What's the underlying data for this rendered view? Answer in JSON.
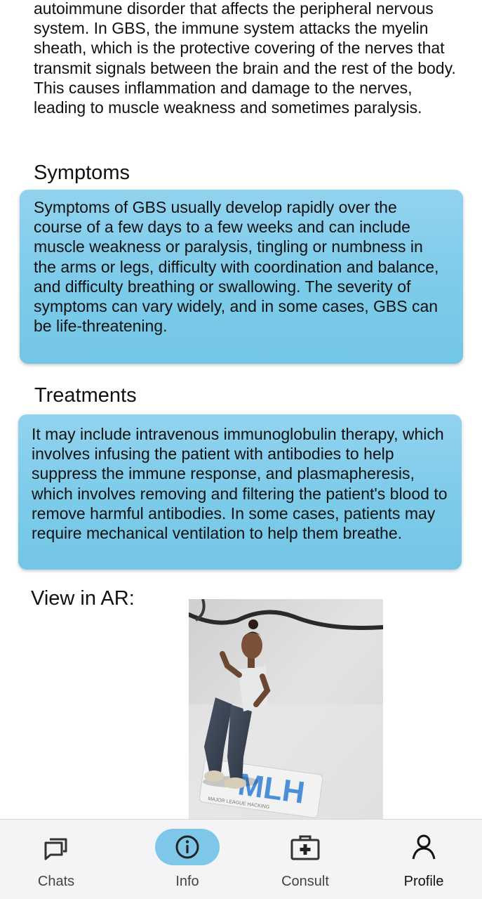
{
  "intro": {
    "text": "autoimmune disorder that affects the peripheral nervous system. In GBS, the immune system attacks the myelin sheath, which is the protective covering of the nerves that transmit signals between the brain and the rest of the body. This causes inflammation and damage to the nerves, leading to muscle weakness and sometimes paralysis."
  },
  "symptoms": {
    "title": "Symptoms",
    "text": "Symptoms of GBS usually develop rapidly over the course of a few days to a few weeks and can include muscle weakness or paralysis, tingling or numbness in the arms or legs, difficulty with coordination and balance, and difficulty breathing or swallowing. The severity of symptoms can vary widely, and in some cases, GBS can be life-threatening."
  },
  "treatments": {
    "title": "Treatments",
    "text": "It may include intravenous immunoglobulin therapy, which involves infusing the patient with antibodies to help suppress the immune response, and plasmapheresis, which involves removing and filtering the patient's blood to remove harmful antibodies. In some cases, patients may require mechanical ventilation to help them breathe."
  },
  "ar": {
    "label": "View in AR:",
    "marker_text": "MLH",
    "marker_subtext": "MAJOR LEAGUE HACKING"
  },
  "nav": {
    "items": [
      {
        "label": "Chats",
        "icon": "chats-icon",
        "active": false
      },
      {
        "label": "Info",
        "icon": "info-icon",
        "active": true
      },
      {
        "label": "Consult",
        "icon": "medical-kit-icon",
        "active": false
      },
      {
        "label": "Profile",
        "icon": "person-icon",
        "active": false
      }
    ]
  },
  "colors": {
    "card": "#7ccbe9",
    "active_nav": "#7fc7e8",
    "nav_bg": "#f4f4f6"
  }
}
